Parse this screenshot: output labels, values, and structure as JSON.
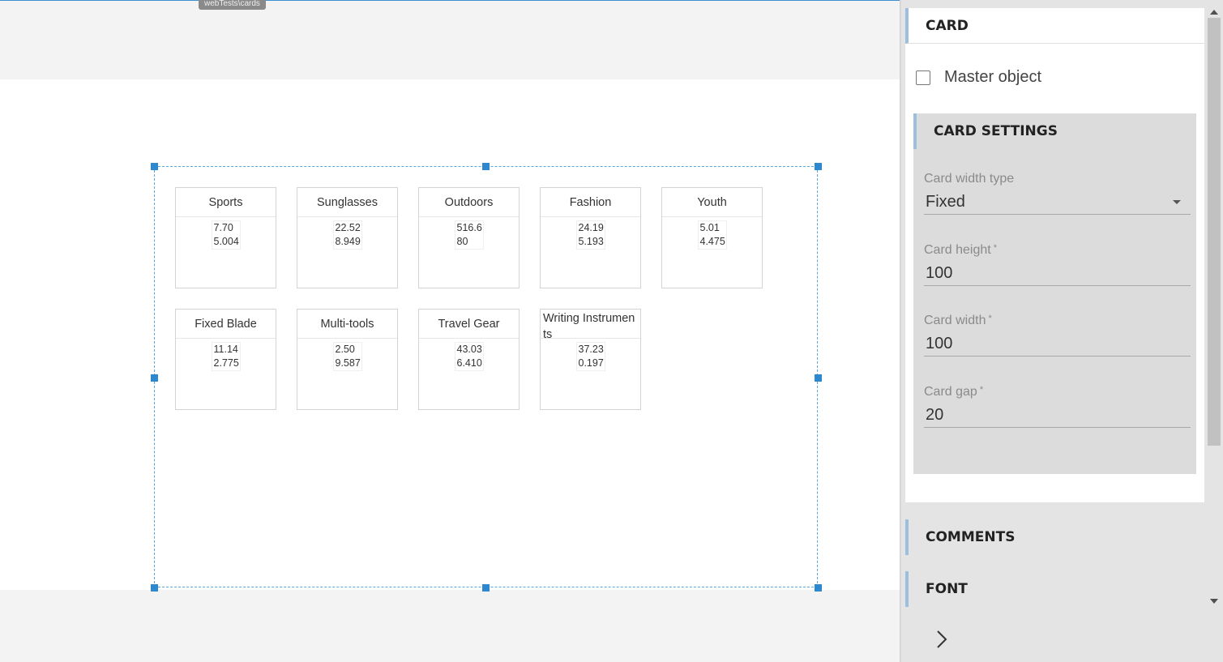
{
  "header": {
    "path_tag": "webTests\\cards"
  },
  "cards": [
    {
      "title": "Sports",
      "v1": "7.70",
      "v2": "5.004"
    },
    {
      "title": "Sunglasses",
      "v1": "22.52",
      "v2": "8.949"
    },
    {
      "title": "Outdoors",
      "v1": "516.6",
      "v2": "80"
    },
    {
      "title": "Fashion",
      "v1": "24.19",
      "v2": "5.193"
    },
    {
      "title": "Youth",
      "v1": "5.01",
      "v2": "4.475"
    },
    {
      "title": "Fixed Blade",
      "v1": "11.14",
      "v2": "2.775"
    },
    {
      "title": "Multi-tools",
      "v1": "2.50",
      "v2": "9.587"
    },
    {
      "title": "Travel Gear",
      "v1": "43.03",
      "v2": "6.410"
    },
    {
      "title": "Writing Instruments",
      "v1": "37.23",
      "v2": "0.197"
    }
  ],
  "panel": {
    "card_title": "CARD",
    "master_object_label": "Master object",
    "master_object_checked": false,
    "settings_title": "CARD SETTINGS",
    "width_type": {
      "label": "Card width type",
      "value": "Fixed"
    },
    "height": {
      "label": "Card height",
      "required": "*",
      "value": "100"
    },
    "width": {
      "label": "Card width",
      "required": "*",
      "value": "100"
    },
    "gap": {
      "label": "Card gap",
      "required": "*",
      "value": "20"
    },
    "comments_title": "COMMENTS",
    "font_title": "FONT"
  },
  "icons": [
    "chevron-right-icon",
    "dropdown-caret-icon",
    "scroll-up-icon",
    "scroll-down-icon"
  ],
  "colors": {
    "accent": "#2e88cf",
    "section_bar": "#9cbfdf",
    "panel_bg": "#e4e4e4"
  }
}
